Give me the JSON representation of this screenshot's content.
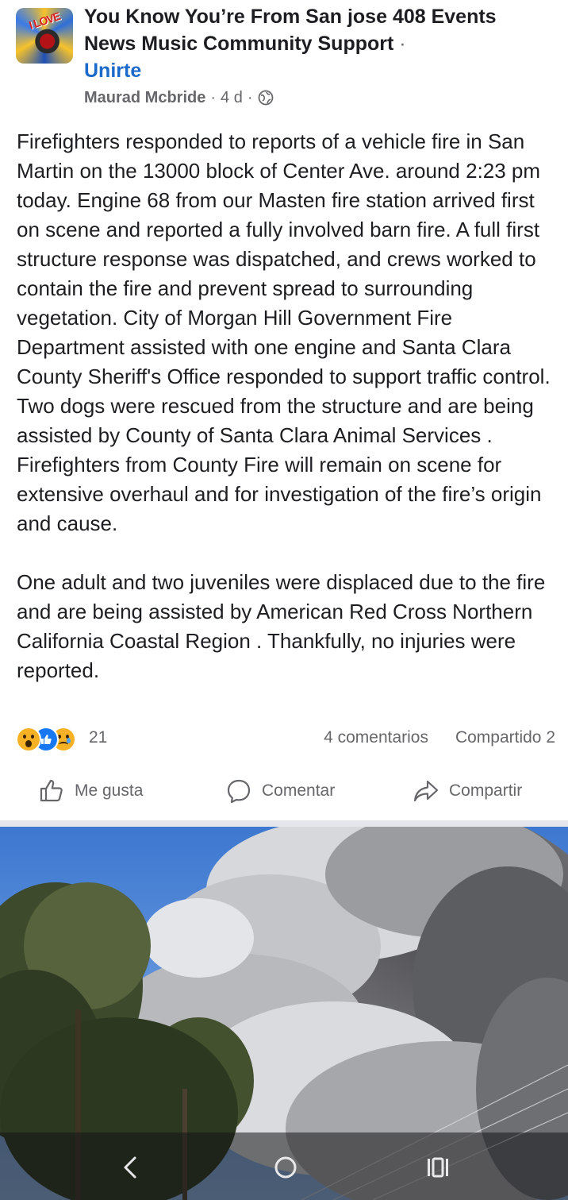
{
  "group": {
    "name": "You Know You’re From San jose 408 Events News Music Community Support",
    "separator": "·",
    "join_label": "Unirte",
    "avatar_text": "I LOVE"
  },
  "post": {
    "author": "Maurad Mcbride",
    "time": "4 d",
    "meta_separator": "·",
    "visibility_icon": "globe-icon",
    "paragraphs": [
      "Firefighters responded to reports of a vehicle fire in San Martin on the 13000 block of Center Ave. around 2:23 pm today. Engine 68 from our Masten fire station arrived first on scene and reported a fully involved barn fire. A full first structure response was dispatched, and crews worked to contain the fire and prevent spread to surrounding vegetation. City of Morgan Hill Government  Fire Department assisted with one engine and Santa Clara County Sheriff's Office  responded to support traffic control. Two dogs were rescued from the structure and are being assisted by County of Santa Clara Animal Services . Firefighters from County Fire will remain on scene for extensive overhaul and for investigation of the fire’s origin and cause.",
      "One adult and two juveniles were displaced due to the fire and are being assisted by American Red Cross Northern California Coastal Region . Thankfully, no injuries were reported."
    ]
  },
  "engagement": {
    "reactions": [
      "wow",
      "like",
      "sad"
    ],
    "reaction_count": "21",
    "comments": "4 comentarios",
    "shares": "Compartido 2"
  },
  "actions": {
    "like": "Me gusta",
    "comment": "Comentar",
    "share": "Compartir"
  },
  "nav": {
    "icons": [
      "back-icon",
      "home-icon",
      "recents-icon"
    ]
  },
  "colors": {
    "link": "#1b6ac9",
    "secondary_text": "#65676b",
    "primary_text": "#1c1e21",
    "divider": "#e4e6eb"
  }
}
